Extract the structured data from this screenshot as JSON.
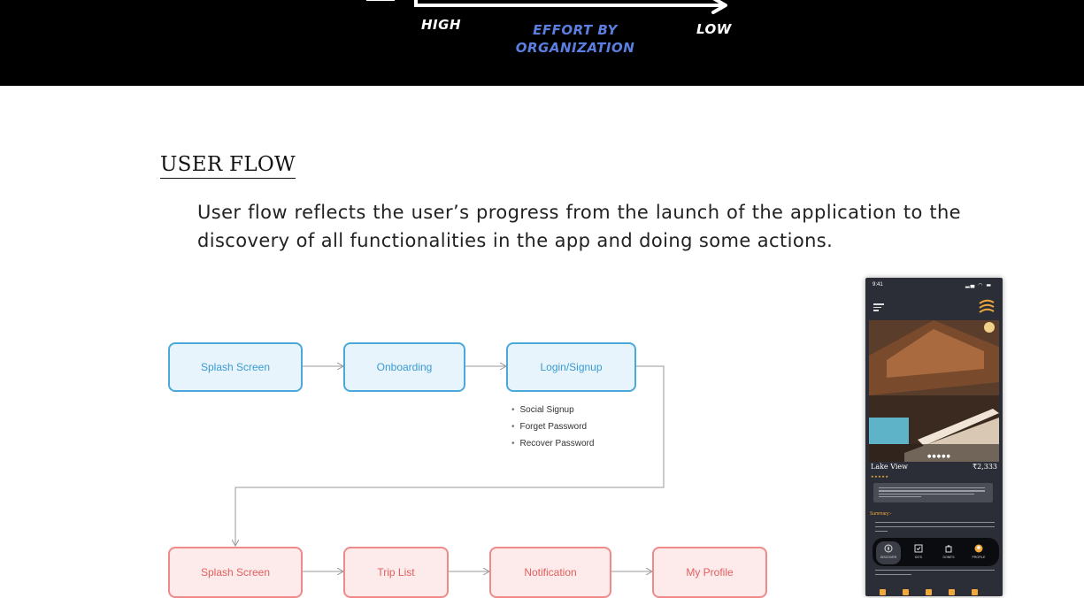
{
  "axis": {
    "left_label": "HIGH",
    "center_label_line1": "EFFORT BY",
    "center_label_line2": "ORGANIZATION",
    "right_label": "LOW"
  },
  "section": {
    "title": "USER FLOW",
    "intro": "User flow reflects the user’s progress from the launch of the application to the discovery of all functionalities in the app and doing some actions."
  },
  "flow": {
    "row1": [
      "Splash Screen",
      "Onboarding",
      "Login/Signup"
    ],
    "login_options": [
      "Social Signup",
      "Forget Password",
      "Recover Password"
    ],
    "row2": [
      "Splash Screen",
      "Trip List",
      "Notification",
      "My Profile"
    ],
    "colors": {
      "row1_border": "#4aa9d8",
      "row1_fill": "#e8f4fb",
      "row2_border": "#ee8a8a",
      "row2_fill": "#fdeaea"
    }
  },
  "phone": {
    "time": "9:41",
    "status_icons": "signal-wifi-battery-icons",
    "place_title": "Lake View",
    "price": "₹2,333",
    "summary_label": "Summary:-",
    "tabs": [
      "DISCOVER",
      "DO'S",
      "DONE'S",
      "PROFILE"
    ],
    "accent": "#f0a73c"
  }
}
